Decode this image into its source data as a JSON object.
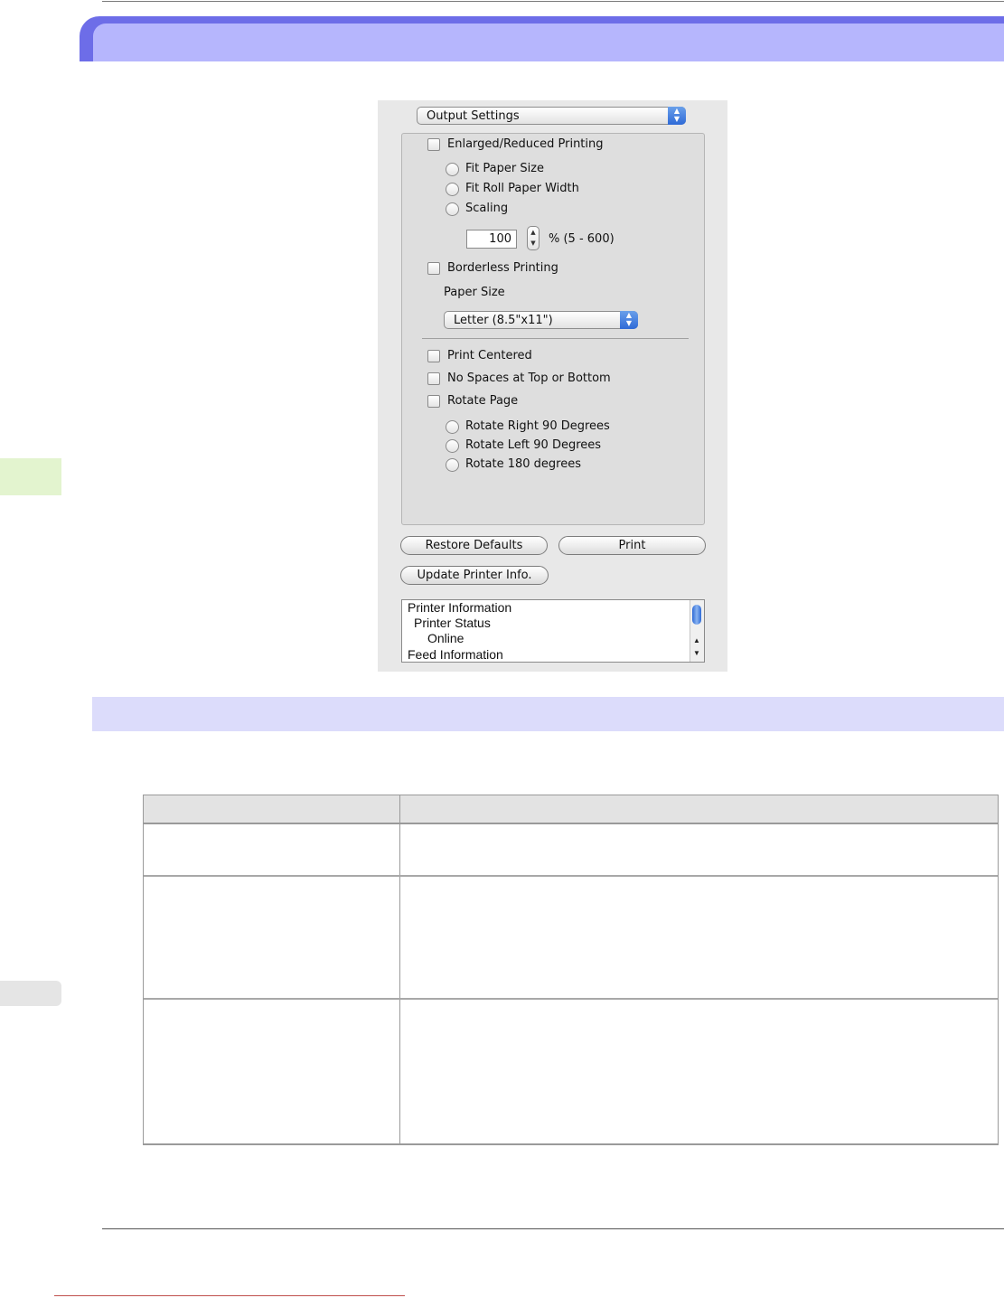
{
  "dialog": {
    "panel_popup": "Output Settings",
    "enlarged_reduced": "Enlarged/Reduced Printing",
    "fit_paper_size": "Fit Paper Size",
    "fit_roll_paper_width": "Fit Roll Paper Width",
    "scaling": "Scaling",
    "scaling_value": "100",
    "scaling_range": "% (5 - 600)",
    "borderless": "Borderless Printing",
    "paper_size_label": "Paper Size",
    "paper_size_value": "Letter (8.5\"x11\")",
    "print_centered": "Print Centered",
    "no_spaces": "No Spaces at Top or Bottom",
    "rotate_page": "Rotate Page",
    "rotate_right": "Rotate Right 90 Degrees",
    "rotate_left": "Rotate Left 90 Degrees",
    "rotate_180": "Rotate 180 degrees",
    "restore_defaults": "Restore Defaults",
    "print": "Print",
    "update_printer_info": "Update Printer Info.",
    "info_list": [
      "Printer Information",
      "Printer Status",
      "Online",
      "Feed Information"
    ]
  },
  "colors": {
    "title_bar": "#b6b6fd",
    "title_bar_edge": "#6d6de8",
    "section_bar": "#dcdcfb",
    "table_header": "#e3e3e3"
  }
}
